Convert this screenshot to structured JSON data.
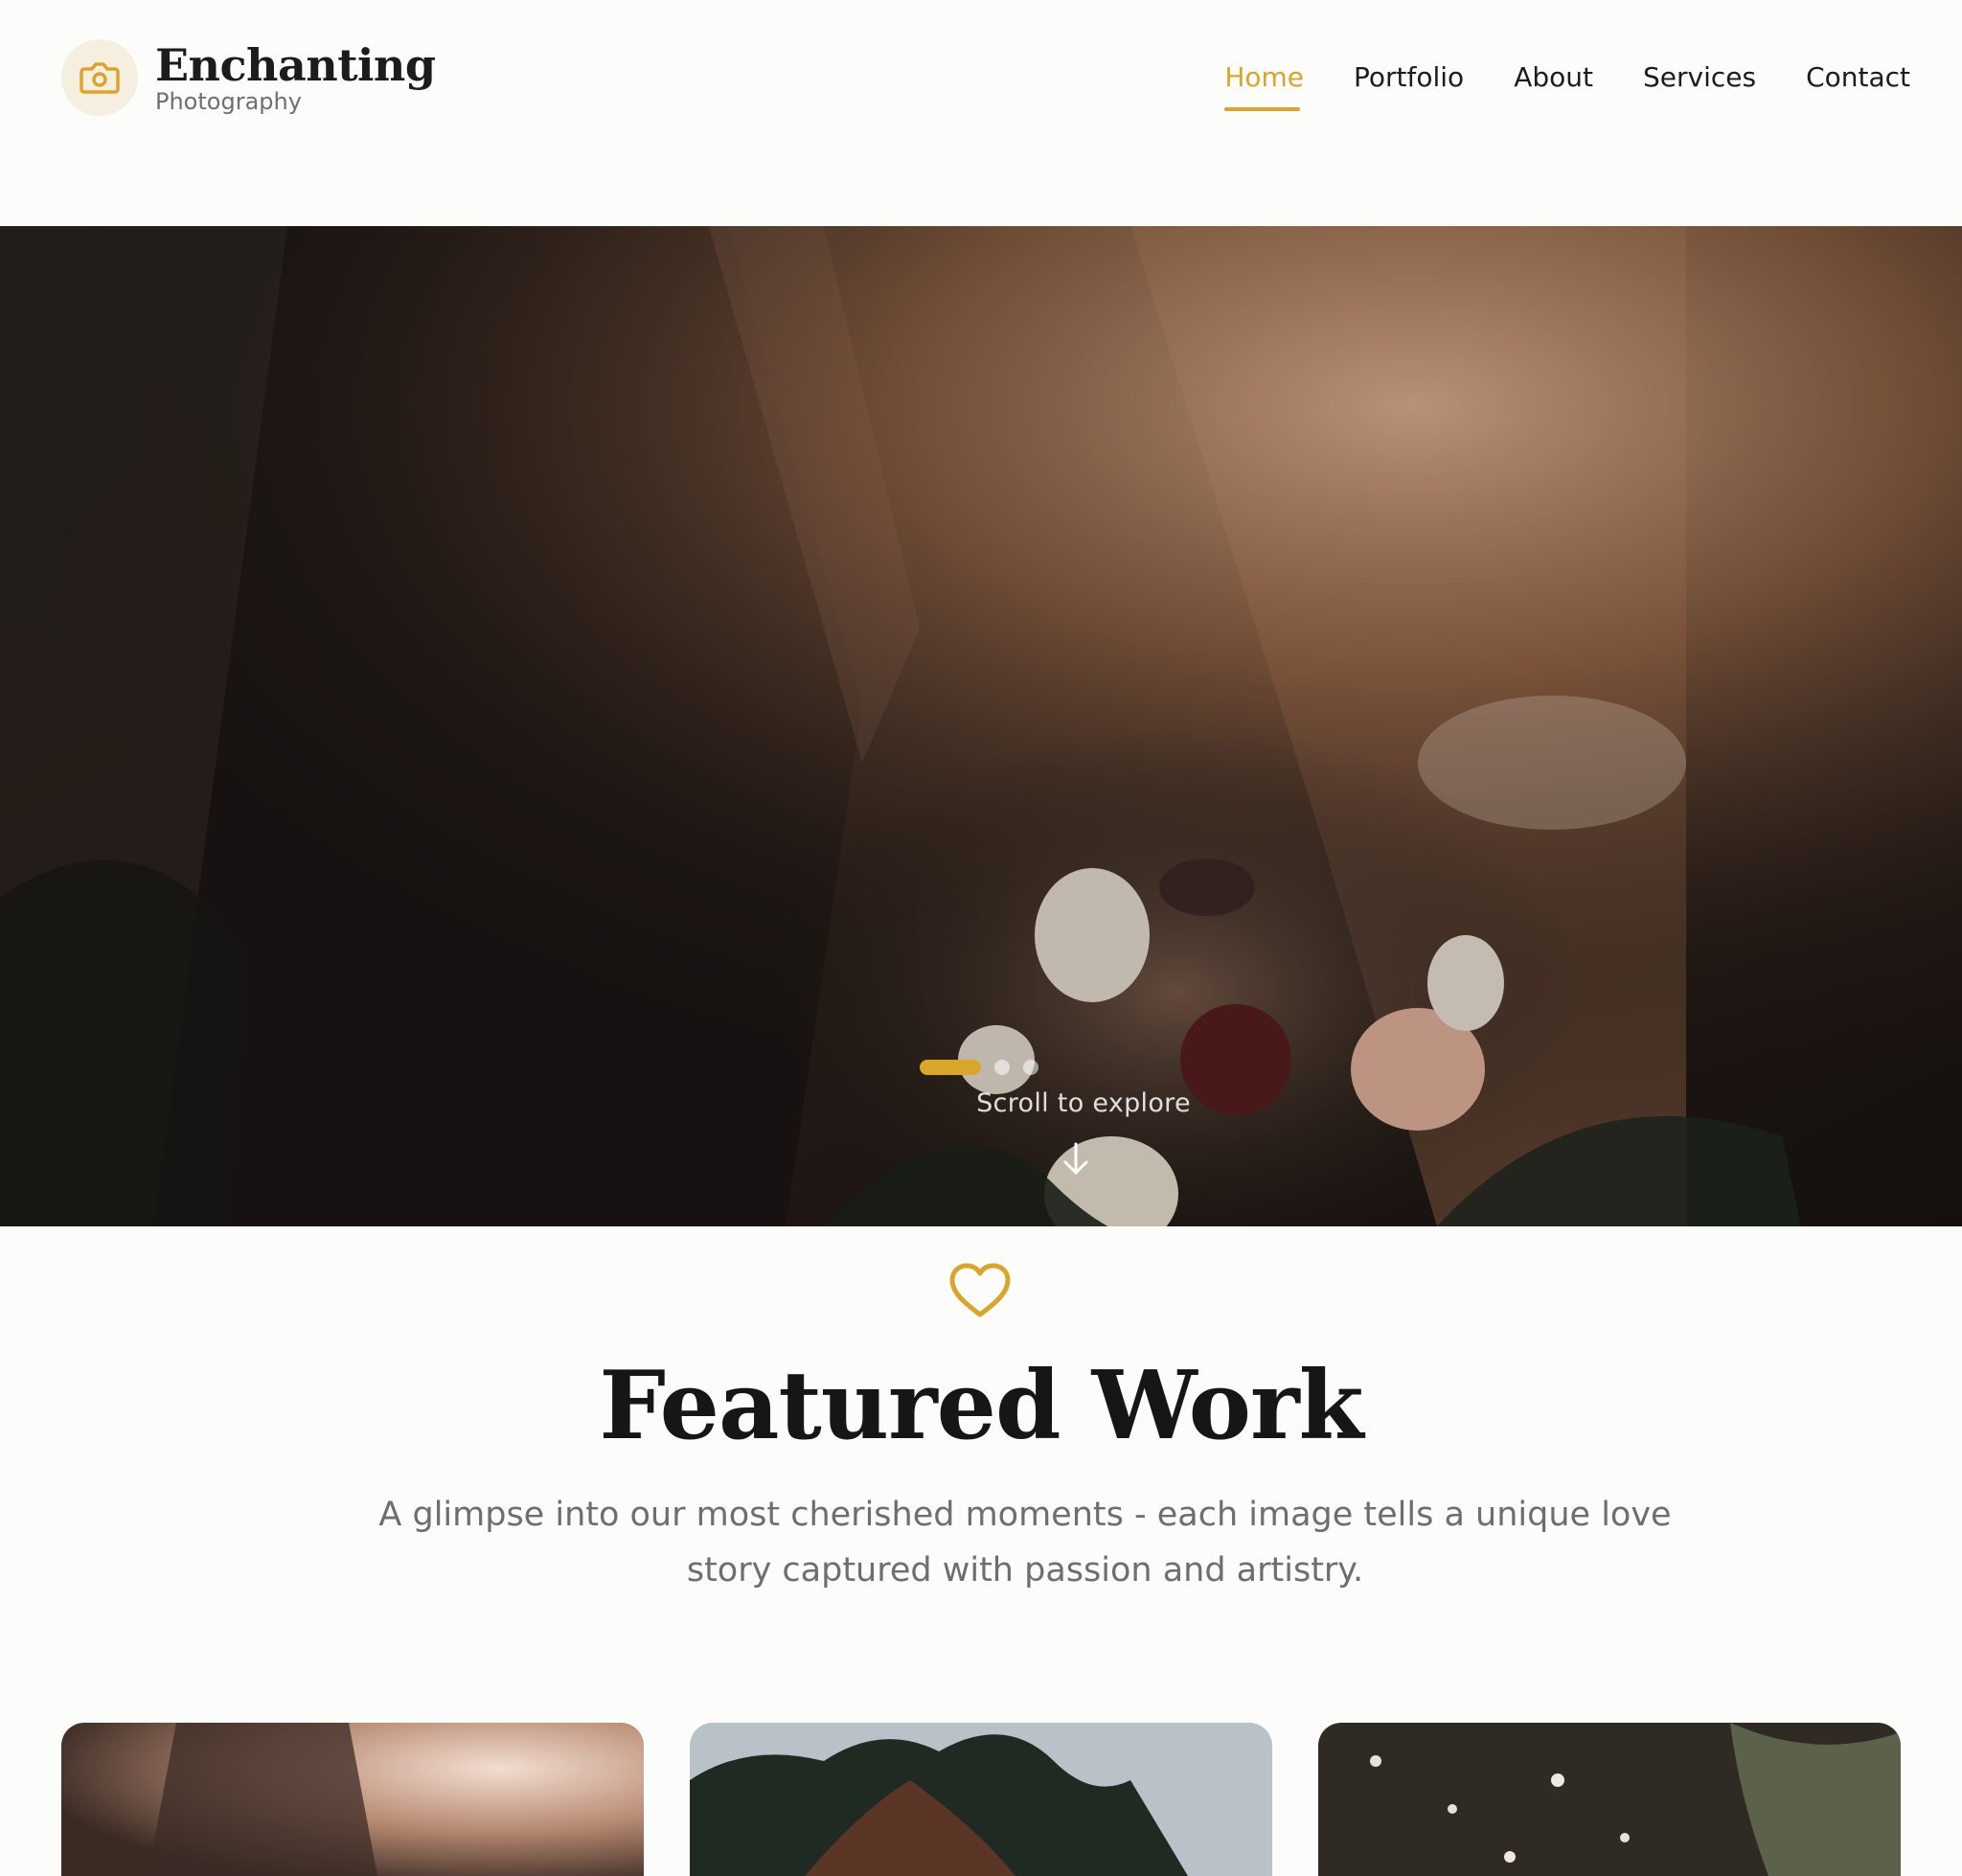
{
  "brand": {
    "title": "Enchanting",
    "subtitle": "Photography",
    "logo_icon": "camera-icon",
    "accent_color": "#d9a52b"
  },
  "nav": {
    "items": [
      {
        "label": "Home",
        "active": true
      },
      {
        "label": "Portfolio",
        "active": false
      },
      {
        "label": "About",
        "active": false
      },
      {
        "label": "Services",
        "active": false
      },
      {
        "label": "Contact",
        "active": false
      }
    ]
  },
  "hero": {
    "slide_count": 3,
    "active_slide": 1,
    "scroll_label": "Scroll to explore",
    "scroll_icon": "arrow-down-icon"
  },
  "featured": {
    "icon": "heart-icon",
    "title": "Featured Work",
    "subtitle": "A glimpse into our most cherished moments - each image tells a unique love story captured with passion and artistry."
  },
  "gallery": {
    "cards": [
      {
        "name": "gallery-card-1"
      },
      {
        "name": "gallery-card-2"
      },
      {
        "name": "gallery-card-3"
      }
    ]
  }
}
